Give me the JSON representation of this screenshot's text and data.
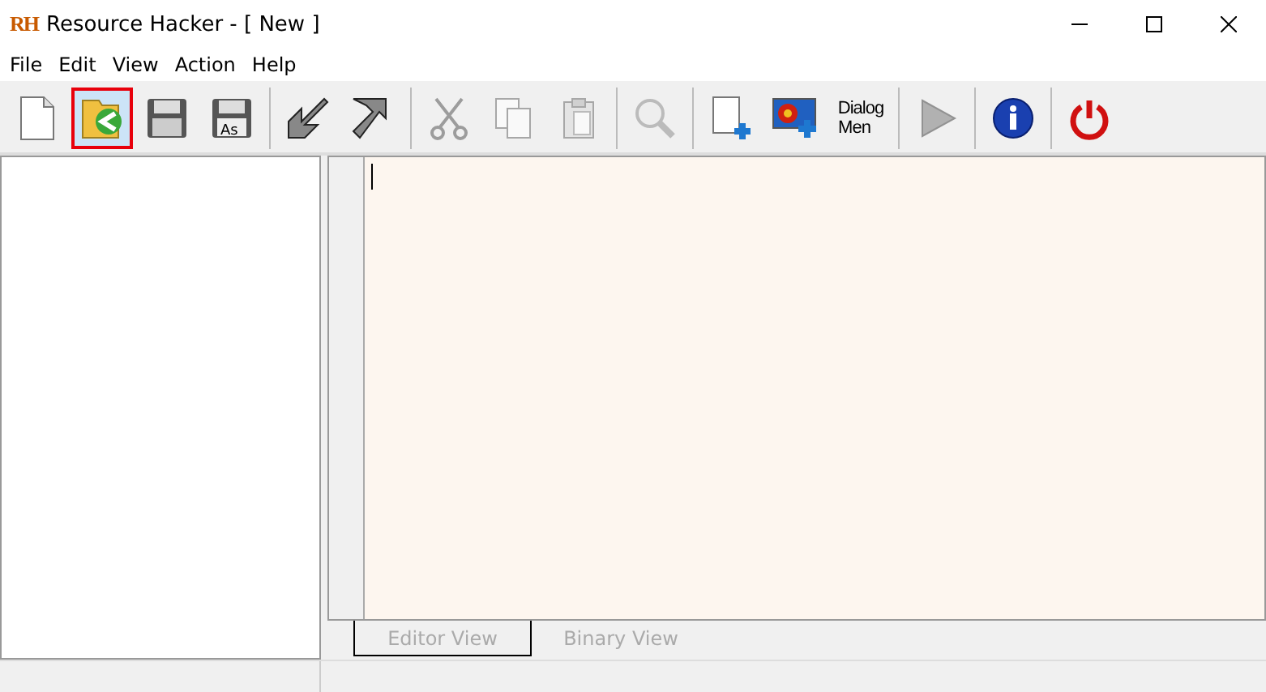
{
  "window": {
    "logo": "RH",
    "title": "Resource Hacker - [ New ]"
  },
  "menu": [
    "File",
    "Edit",
    "View",
    "Action",
    "Help"
  ],
  "toolbar_groups": [
    [
      {
        "kind": "new",
        "selected": false,
        "disabled": false
      },
      {
        "kind": "open",
        "selected": true,
        "disabled": false
      },
      {
        "kind": "save",
        "selected": false,
        "disabled": false
      },
      {
        "kind": "saveas",
        "label": "As",
        "selected": false,
        "disabled": false
      }
    ],
    [
      {
        "kind": "import",
        "selected": false,
        "disabled": false
      },
      {
        "kind": "export",
        "selected": false,
        "disabled": false
      }
    ],
    [
      {
        "kind": "cut",
        "selected": false,
        "disabled": true
      },
      {
        "kind": "copy",
        "selected": false,
        "disabled": true
      },
      {
        "kind": "paste",
        "selected": false,
        "disabled": true
      }
    ],
    [
      {
        "kind": "search",
        "selected": false,
        "disabled": true
      }
    ],
    [
      {
        "kind": "addblank",
        "selected": false,
        "disabled": false
      },
      {
        "kind": "addimage",
        "selected": false,
        "disabled": false
      },
      {
        "kind": "adddialog",
        "label": "Dialog",
        "label2": "Men",
        "selected": false,
        "disabled": false
      }
    ],
    [
      {
        "kind": "run",
        "selected": false,
        "disabled": true
      }
    ],
    [
      {
        "kind": "info",
        "selected": false,
        "disabled": false
      }
    ],
    [
      {
        "kind": "power",
        "selected": false,
        "disabled": false
      }
    ]
  ],
  "tabs": [
    {
      "label": "Editor View",
      "selected": true
    },
    {
      "label": "Binary View",
      "selected": false
    }
  ]
}
